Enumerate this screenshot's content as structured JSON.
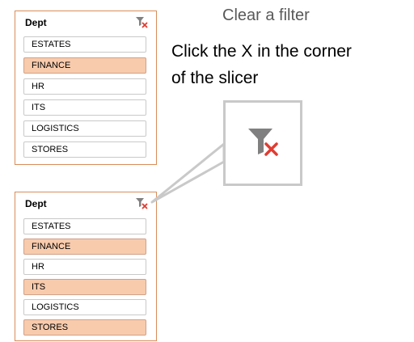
{
  "slicer_top": {
    "title": "Dept",
    "items": [
      {
        "label": "ESTATES",
        "selected": false
      },
      {
        "label": "FINANCE",
        "selected": true
      },
      {
        "label": "HR",
        "selected": false
      },
      {
        "label": "ITS",
        "selected": false
      },
      {
        "label": "LOGISTICS",
        "selected": false
      },
      {
        "label": "STORES",
        "selected": false
      }
    ]
  },
  "slicer_bottom": {
    "title": "Dept",
    "items": [
      {
        "label": "ESTATES",
        "selected": false
      },
      {
        "label": "FINANCE",
        "selected": true
      },
      {
        "label": "HR",
        "selected": false
      },
      {
        "label": "ITS",
        "selected": true
      },
      {
        "label": "LOGISTICS",
        "selected": false
      },
      {
        "label": "STORES",
        "selected": true
      }
    ]
  },
  "instructions": {
    "heading": "Clear a filter",
    "line1": "Click the X in the corner",
    "line2": "of the slicer"
  },
  "icons": {
    "clear_filter": "clear-filter-icon"
  },
  "colors": {
    "selected_fill": "#f8cbad",
    "slicer_border": "#d98e5a",
    "clear_x": "#e03c31"
  }
}
